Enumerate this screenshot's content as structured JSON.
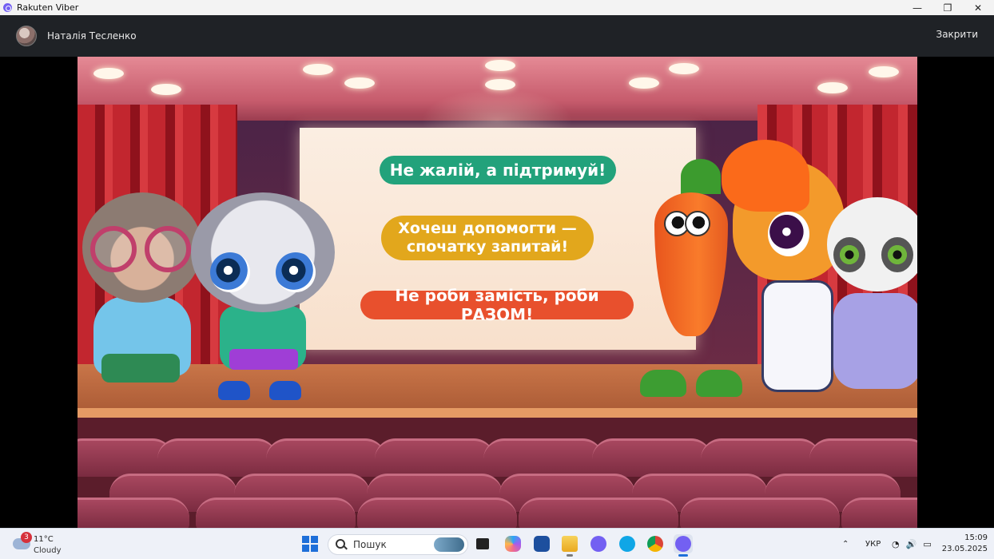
{
  "window": {
    "title": "Rakuten Viber",
    "controls": {
      "minimize": "—",
      "restore": "❐",
      "close": "✕"
    }
  },
  "viewer": {
    "contact_name": "Наталія Тесленко",
    "close_label": "Закрити"
  },
  "slide": {
    "messages": [
      "Не жалій, а підтримуй!",
      "Хочеш допомогти —\nспочатку запитай!",
      "Не роби замість, роби РАЗОМ!"
    ],
    "message_colors": [
      "#22a27b",
      "#e2a71c",
      "#e8502d"
    ]
  },
  "taskbar": {
    "weather": {
      "badge": "3",
      "temperature": "11°C",
      "condition": "Cloudy"
    },
    "search_placeholder": "Пошук",
    "apps": [
      "start-icon",
      "file-explorer-icon",
      "copilot-icon",
      "store-icon",
      "folder-icon",
      "viber-icon",
      "skype-icon",
      "chrome-icon",
      "viber-active-icon"
    ],
    "tray": {
      "chevron": "⌃",
      "language": "УКР",
      "wifi": "◔",
      "volume": "🔊",
      "battery": "▭"
    },
    "clock": {
      "time": "15:09",
      "date": "23.05.2025"
    }
  }
}
